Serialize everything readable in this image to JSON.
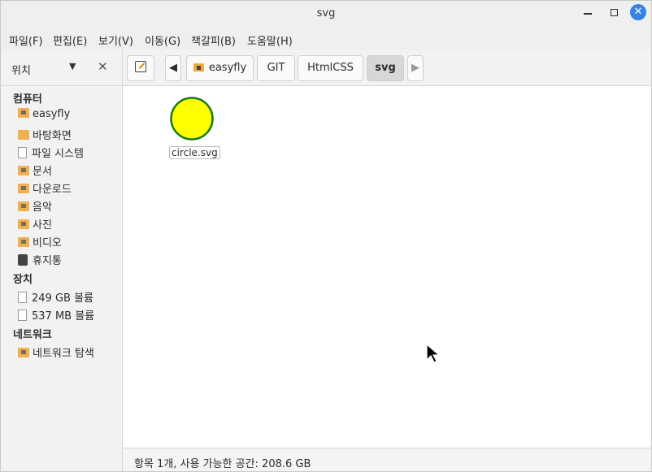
{
  "window": {
    "title": "svg",
    "close_symbol": "✕"
  },
  "menu": {
    "items": [
      "파일(F)",
      "편집(E)",
      "보기(V)",
      "이동(G)",
      "책갈피(B)",
      "도움말(H)"
    ]
  },
  "sidebar_header": {
    "label": "위치",
    "dropdown_arrow": "▼",
    "close": "✕"
  },
  "toolbar": {
    "nav_left": "◀",
    "nav_right": "▶",
    "breadcrumbs": [
      "easyfly",
      "GIT",
      "HtmlCSS",
      "svg"
    ],
    "active_crumb": "svg"
  },
  "sidebar": {
    "sections": [
      {
        "title": "컴퓨터",
        "items": [
          "easyfly",
          "바탕화면",
          "파일 시스템",
          "문서",
          "다운로드",
          "음악",
          "사진",
          "비디오",
          "휴지통"
        ]
      },
      {
        "title": "장치",
        "items": [
          "249 GB 볼륨",
          "537 MB 볼륨"
        ]
      },
      {
        "title": "네트워크",
        "items": [
          "네트워크 탐색"
        ]
      }
    ]
  },
  "content": {
    "files": [
      {
        "name": "circle.svg",
        "fill_color": "#ffff00",
        "stroke_color": "#1a7a1a"
      }
    ]
  },
  "status": {
    "text": "항목 1개, 사용 가능한 공간: 208.6 GB"
  },
  "colors": {
    "accent": "#3584e4",
    "folder": "#f0b04f"
  }
}
